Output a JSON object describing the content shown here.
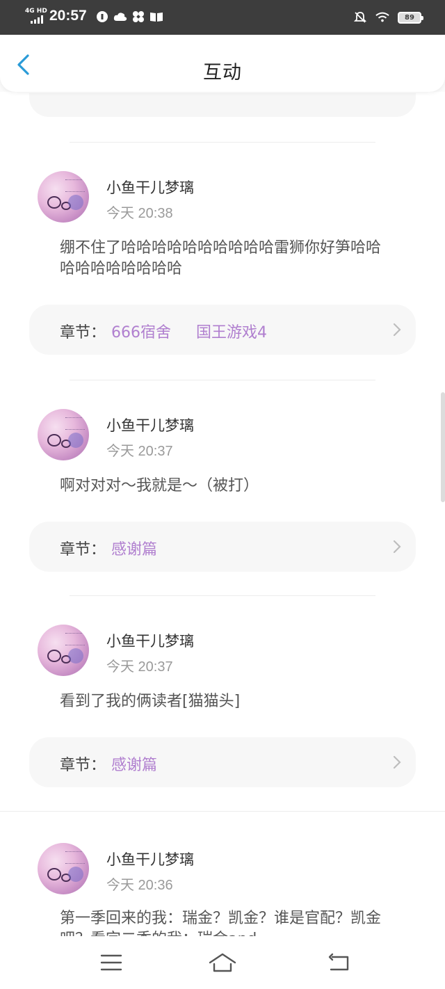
{
  "status_bar": {
    "network": "4G HD",
    "time": "20:57",
    "battery": "89"
  },
  "header": {
    "title": "互动"
  },
  "comments": [
    {
      "username": "小鱼干儿梦璃",
      "time": "今天 20:38",
      "text": "绷不住了哈哈哈哈哈哈哈哈哈哈雷狮你好笋哈哈哈哈哈哈哈哈哈哈",
      "chapter_label": "章节：",
      "chapters": [
        "666宿舍",
        "国王游戏4"
      ]
    },
    {
      "username": "小鱼干儿梦璃",
      "time": "今天 20:37",
      "text": "啊对对对～我就是～（被打）",
      "chapter_label": "章节：",
      "chapters": [
        "感谢篇"
      ]
    },
    {
      "username": "小鱼干儿梦璃",
      "time": "今天 20:37",
      "text": "看到了我的俩读者[猫猫头]",
      "chapter_label": "章节：",
      "chapters": [
        "感谢篇"
      ]
    },
    {
      "username": "小鱼干儿梦璃",
      "time": "今天 20:36",
      "text": "第一季回来的我：瑞金？凯金？谁是官配？凯金吧？看完二季的我：瑞金and",
      "chapter_label": "",
      "chapters": []
    }
  ],
  "colors": {
    "accent": "#2a9bd7",
    "chapter_link": "#b07fcf",
    "status_bar_bg": "#3d3d3d"
  },
  "icons": {
    "back": "chevron-left-icon",
    "chapter_arrow": "chevron-right-icon",
    "nav_menu": "menu-icon",
    "nav_home": "home-icon",
    "nav_back": "return-icon"
  }
}
